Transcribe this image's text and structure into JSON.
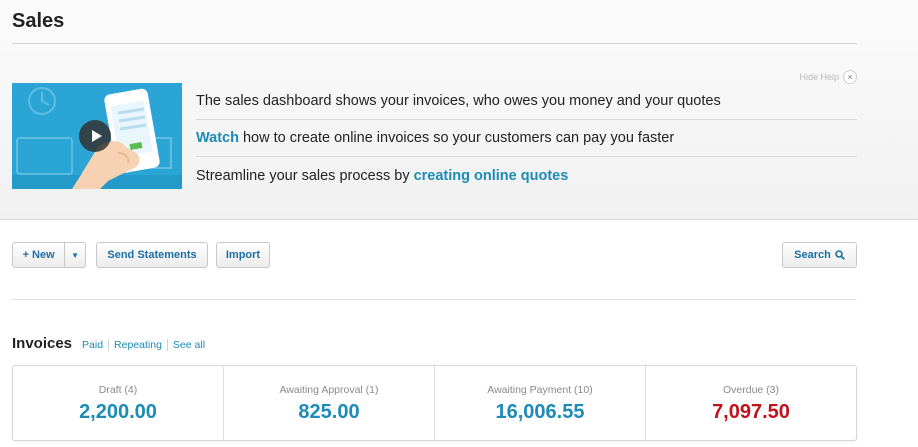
{
  "page": {
    "title": "Sales"
  },
  "help": {
    "hide_label": "Hide Help",
    "close_glyph": "×",
    "video_icon": "play-icon",
    "line1": "The sales dashboard shows your invoices, who owes you money and your quotes",
    "line2_link": "Watch",
    "line2_text": " how to create online invoices so your customers can pay you faster",
    "line3_text": "Streamline your sales process by ",
    "line3_link": "creating online quotes"
  },
  "toolbar": {
    "new_label": "+ New",
    "caret_glyph": "▼",
    "send_label": "Send Statements",
    "import_label": "Import",
    "search_label": "Search",
    "search_icon": "search-icon"
  },
  "invoices": {
    "title": "Invoices",
    "links": [
      "Paid",
      "Repeating",
      "See all"
    ],
    "cards": [
      {
        "label": "Draft (4)",
        "value": "2,200.00"
      },
      {
        "label": "Awaiting Approval (1)",
        "value": "825.00"
      },
      {
        "label": "Awaiting Payment (10)",
        "value": "16,006.55"
      },
      {
        "label": "Overdue (3)",
        "value": "7,097.50"
      }
    ]
  },
  "colors": {
    "link": "#1c8bb6",
    "overdue": "#c0131b",
    "video_bg": "#2aa5d6"
  }
}
